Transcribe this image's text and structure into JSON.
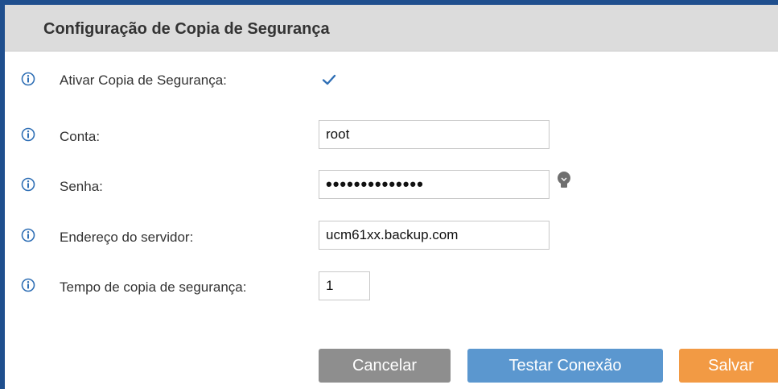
{
  "panel": {
    "title": "Configuração de Copia de Segurança"
  },
  "form": {
    "enable_backup": {
      "label": "Ativar Copia de Segurança:",
      "checked": true
    },
    "account": {
      "label": "Conta:",
      "value": "root"
    },
    "password": {
      "label": "Senha:",
      "value": "••••••••••••••"
    },
    "server_address": {
      "label": "Endereço do servidor:",
      "value": "ucm61xx.backup.com"
    },
    "backup_time": {
      "label": "Tempo de copia de segurança:",
      "value": "1"
    }
  },
  "actions": {
    "cancel_label": "Cancelar",
    "test_label": "Testar Conexão",
    "save_label": "Salvar"
  },
  "colors": {
    "frame": "#1f4f8e",
    "titlebar": "#dcdcdc",
    "info_icon": "#2f6fb5",
    "check": "#2f6fb5",
    "cancel": "#8e8e8e",
    "test": "#5b97cf",
    "save": "#f29a44"
  },
  "icons": {
    "info": "info-circle-icon",
    "check": "checkmark-icon",
    "hint": "lightbulb-icon"
  }
}
